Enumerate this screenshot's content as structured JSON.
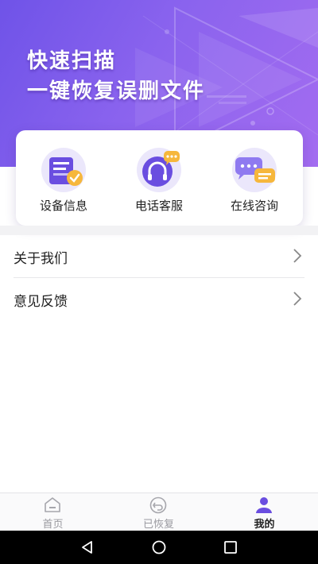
{
  "banner": {
    "line1": "快速扫描",
    "line2": "一键恢复误删文件",
    "gradient_start": "#6f53e8",
    "gradient_end": "#a36cf0"
  },
  "card": {
    "items": [
      {
        "label": "设备信息",
        "icon": "device-info-icon"
      },
      {
        "label": "电话客服",
        "icon": "phone-service-icon"
      },
      {
        "label": "在线咨询",
        "icon": "online-chat-icon"
      }
    ]
  },
  "menu": {
    "items": [
      {
        "label": "关于我们",
        "icon": "chevron-right-icon"
      },
      {
        "label": "意见反馈",
        "icon": "chevron-right-icon"
      }
    ]
  },
  "tabbar": {
    "tabs": [
      {
        "label": "首页",
        "icon": "home-icon"
      },
      {
        "label": "已恢复",
        "icon": "restore-icon"
      },
      {
        "label": "我的",
        "icon": "profile-icon",
        "active": true
      }
    ],
    "active_color": "#6a4ee0"
  },
  "sysnav": {
    "buttons": [
      "back-icon",
      "home-circle-icon",
      "recents-icon"
    ]
  }
}
